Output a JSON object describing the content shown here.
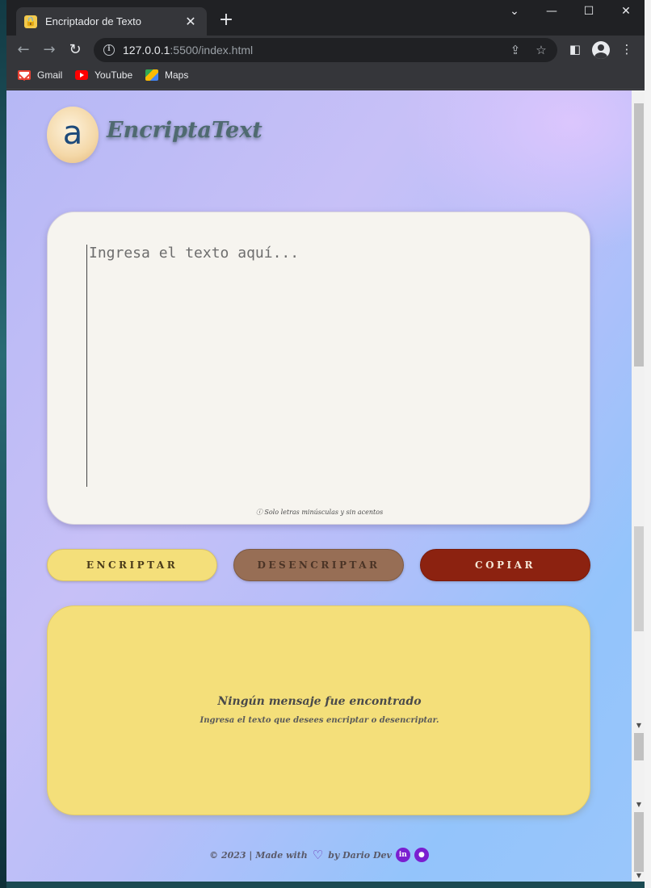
{
  "browser": {
    "tab_title": "Encriptador de Texto",
    "url_host": "127.0.0.1",
    "url_path": ":5500/index.html",
    "bookmarks": [
      "Gmail",
      "YouTube",
      "Maps"
    ]
  },
  "app": {
    "brand": "EncriptaText",
    "logo_letter": "a",
    "placeholder": "Ingresa el texto aquí...",
    "hint": "ⓘ Solo letras minúsculas y sin acentos",
    "buttons": {
      "encrypt": "ENCRIPTAR",
      "decrypt": "DESENCRIPTAR",
      "copy": "COPIAR"
    },
    "output": {
      "title": "Ningún mensaje fue encontrado",
      "subtitle": "Ingresa el texto que desees encriptar o desencriptar."
    },
    "footer": {
      "prefix": "© 2023 | Made with",
      "suffix": "by Dario Dev"
    }
  },
  "colors": {
    "encrypt": "#f4df7a",
    "decrypt": "#976e55",
    "copy": "#8c2210",
    "card": "#f6f4ef"
  }
}
